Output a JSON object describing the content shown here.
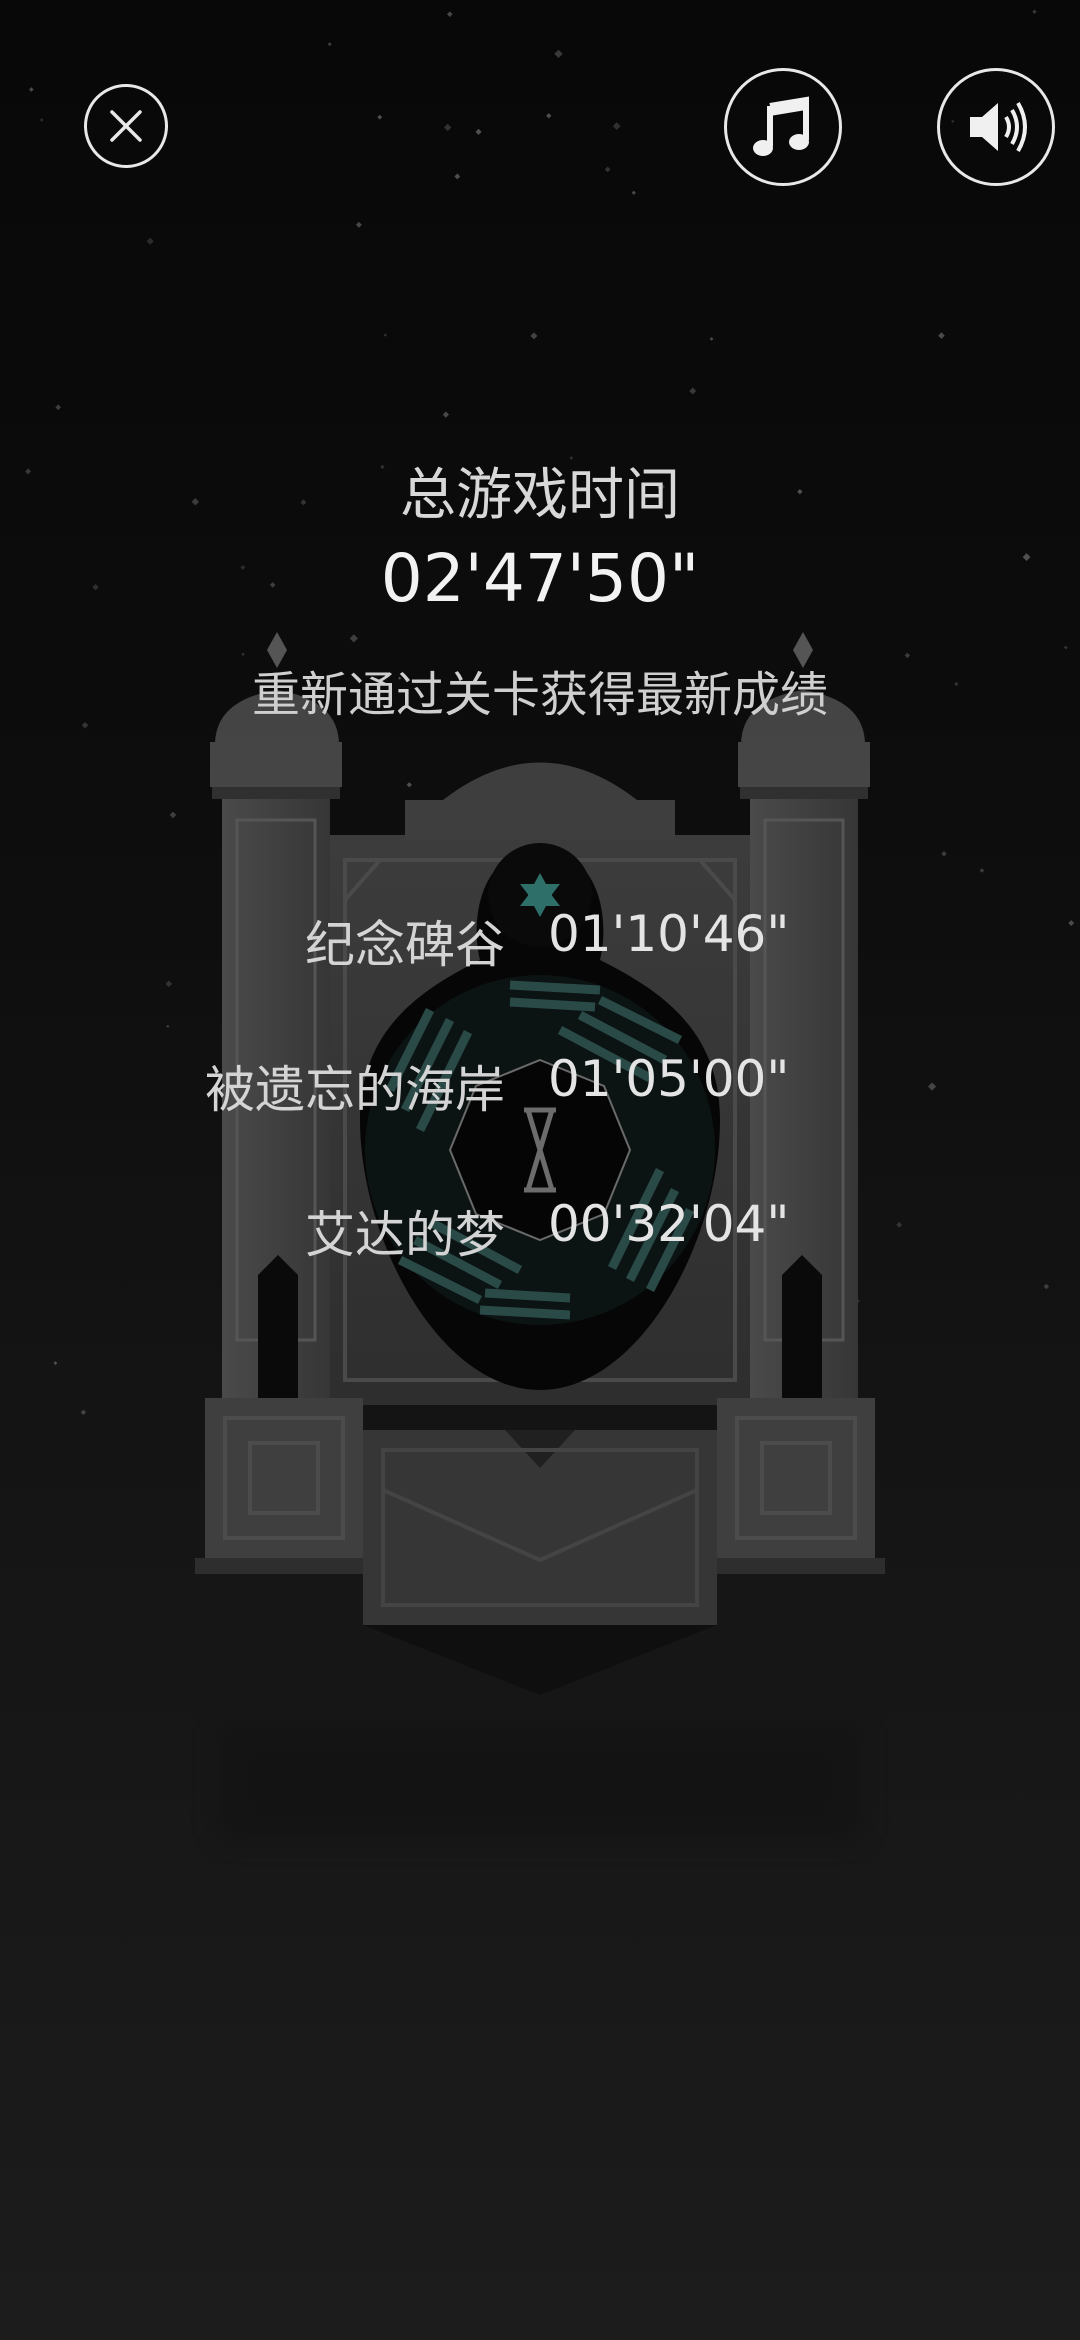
{
  "header": {
    "close_icon": "close-icon",
    "music_icon": "music-note-icon",
    "sound_icon": "speaker-volume-icon"
  },
  "summary": {
    "total_label": "总游戏时间",
    "total_time": "02'47'50\"",
    "hint": "重新通过关卡获得最新成绩"
  },
  "levels": [
    {
      "name": "纪念碑谷",
      "time": "01'10'46\""
    },
    {
      "name": "被遗忘的海岸",
      "time": "01'05'00\""
    },
    {
      "name": "艾达的梦",
      "time": "00'32'04\""
    }
  ],
  "colors": {
    "background": "#0a0a0a",
    "monument_stone": "#3a3a3a",
    "accent_teal": "#2f6f6a",
    "text": "#d6d6d6"
  }
}
